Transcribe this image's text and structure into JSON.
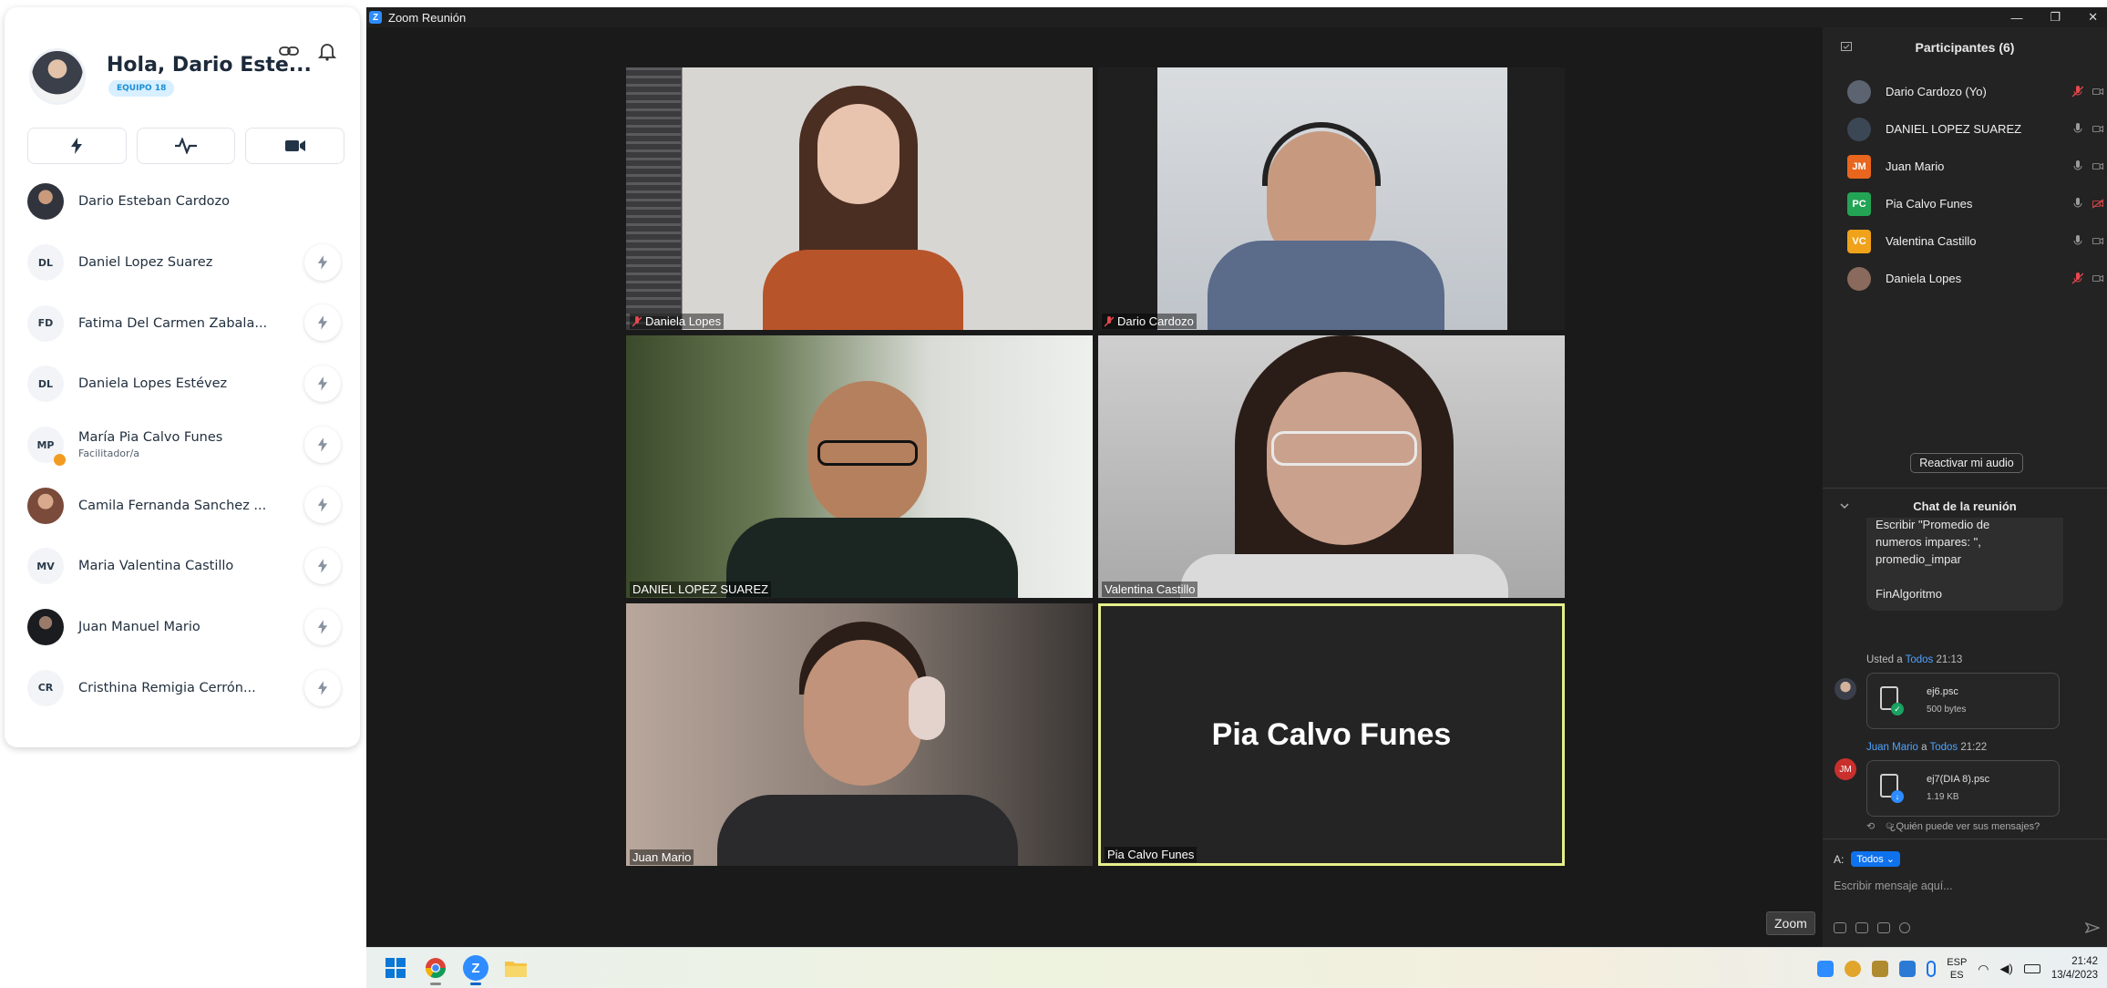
{
  "left_panel": {
    "greeting": "Hola, Dario Este...",
    "team_badge": "EQUIPO 18",
    "header_icons": [
      "link-icon",
      "bell-icon"
    ],
    "action_buttons": [
      "bolt-icon",
      "activity-icon",
      "video-icon"
    ],
    "members": [
      {
        "initials": "",
        "name": "Dario Esteban Cardozo",
        "subtitle": "",
        "photo": true,
        "bolt": false
      },
      {
        "initials": "DL",
        "name": "Daniel Lopez Suarez",
        "subtitle": "",
        "photo": false,
        "bolt": true
      },
      {
        "initials": "FD",
        "name": "Fatima Del Carmen Zabala...",
        "subtitle": "",
        "photo": false,
        "bolt": true
      },
      {
        "initials": "DL",
        "name": "Daniela Lopes Estévez",
        "subtitle": "",
        "photo": false,
        "bolt": true
      },
      {
        "initials": "MP",
        "name": "María Pia Calvo Funes",
        "subtitle": "Facilitador/a",
        "photo": false,
        "bolt": true
      },
      {
        "initials": "",
        "name": "Camila Fernanda Sanchez ...",
        "subtitle": "",
        "photo": true,
        "bolt": true
      },
      {
        "initials": "MV",
        "name": "Maria Valentina Castillo",
        "subtitle": "",
        "photo": false,
        "bolt": true
      },
      {
        "initials": "",
        "name": "Juan Manuel Mario",
        "subtitle": "",
        "photo": true,
        "bolt": true
      },
      {
        "initials": "CR",
        "name": "Cristhina Remigia Cerrón...",
        "subtitle": "",
        "photo": false,
        "bolt": true
      }
    ]
  },
  "zoom": {
    "window_title": "Zoom Reunión",
    "window_controls": [
      "—",
      "❐",
      "✕"
    ],
    "tiles": [
      {
        "label": "Daniela Lopes",
        "muted": true
      },
      {
        "label": "Dario Cardozo",
        "muted": true
      },
      {
        "label": "DANIEL LOPEZ SUAREZ",
        "muted": false
      },
      {
        "label": "Valentina Castillo",
        "muted": false
      },
      {
        "label": "Juan Mario",
        "muted": false
      },
      {
        "label": "Pia Calvo Funes",
        "muted": false,
        "center_name": "Pia Calvo Funes",
        "active_speaker": true
      }
    ],
    "zoom_button": "Zoom",
    "participants_title": "Participantes (6)",
    "participants": [
      {
        "name": "Dario Cardozo (Yo)",
        "initials": "",
        "color": "#5b6470",
        "mic_muted": true,
        "video_off": false
      },
      {
        "name": "DANIEL LOPEZ SUAREZ",
        "initials": "",
        "color": "#3c4756",
        "mic_muted": false,
        "video_off": false
      },
      {
        "name": "Juan Mario",
        "initials": "JM",
        "color": "#e8661d",
        "mic_muted": false,
        "video_off": false
      },
      {
        "name": "Pia Calvo Funes",
        "initials": "PC",
        "color": "#23a455",
        "mic_muted": false,
        "video_off": true
      },
      {
        "name": "Valentina Castillo",
        "initials": "VC",
        "color": "#f0a21b",
        "mic_muted": false,
        "video_off": false
      },
      {
        "name": "Daniela Lopes",
        "initials": "",
        "color": "#8a6a5c",
        "mic_muted": true,
        "video_off": false
      }
    ],
    "reactivate_audio": "Reactivar mi audio",
    "chat_title": "Chat de la reunión",
    "chat_prev_message": "Escribir \"Promedio de\nnumeros impares: \",\npromedio_impar\n\nFinAlgoritmo",
    "msg1": {
      "prefix": "Usted a ",
      "to": "Todos",
      "time": "21:13",
      "file": "ej6.psc",
      "size": "500 bytes"
    },
    "msg2": {
      "from": "Juan Mario",
      "mid": " a ",
      "to": "Todos",
      "time": "21:22",
      "file": "ej7(DIA 8).psc",
      "size": "1.19 KB",
      "initials": "JM"
    },
    "who_can_see": "¿Quién puede ver sus mensajes?",
    "to_label": "A:",
    "to_value": "Todos",
    "composer_placeholder": "Escribir mensaje aquí..."
  },
  "taskbar": {
    "apps": [
      "windows-start-icon",
      "chrome-icon",
      "zoom-icon",
      "file-explorer-icon"
    ],
    "lang_top": "ESP",
    "lang_bottom": "ES",
    "time": "21:42",
    "date": "13/4/2023"
  },
  "colors": {
    "zoom_blue": "#2d8cff",
    "active_speaker": "#e7ef8a",
    "muted_red": "#e5484d"
  }
}
